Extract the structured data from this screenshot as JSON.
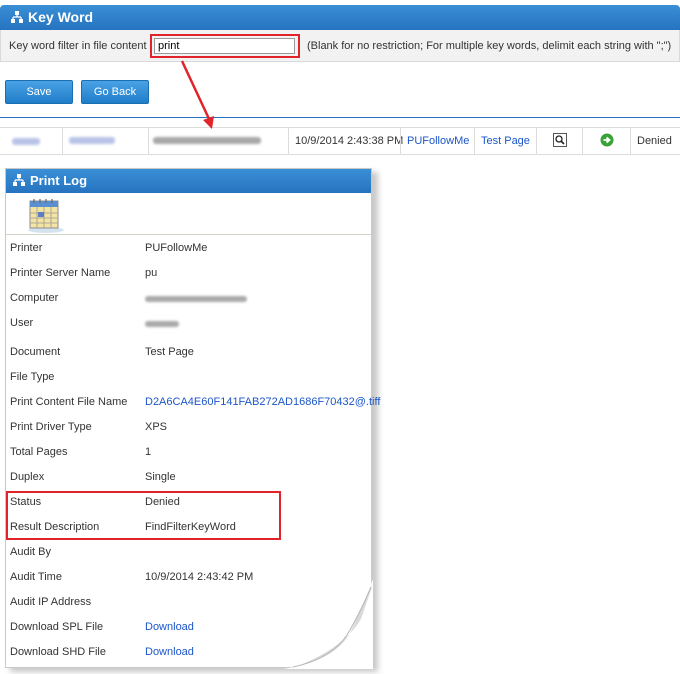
{
  "keyword_panel": {
    "title": "Key Word",
    "filter_label": "Key word filter in file content",
    "filter_value": "print",
    "hint": "(Blank for no restriction; For multiple key words, delimit each string with \";\")",
    "save_label": "Save",
    "back_label": "Go Back"
  },
  "log_row": {
    "datetime": "10/9/2014 2:43:38 PM",
    "printer": "PUFollowMe",
    "document": "Test Page",
    "status": "Denied"
  },
  "print_log": {
    "title": "Print Log",
    "fields": [
      {
        "label": "Printer",
        "value": "PUFollowMe"
      },
      {
        "label": "Printer Server Name",
        "value": "pu"
      },
      {
        "label": "Computer",
        "value": ""
      },
      {
        "label": "User",
        "value": ""
      },
      {
        "label": "Document",
        "value": "Test Page"
      },
      {
        "label": "File Type",
        "value": ""
      },
      {
        "label": "Print Content File Name",
        "value": "D2A6CA4E60F141FAB272AD1686F70432@.tiff"
      },
      {
        "label": "Print Driver Type",
        "value": "XPS"
      },
      {
        "label": "Total Pages",
        "value": "1"
      },
      {
        "label": "Duplex",
        "value": "Single"
      },
      {
        "label": "Status",
        "value": "Denied"
      },
      {
        "label": "Result Description",
        "value": "FindFilterKeyWord"
      },
      {
        "label": "Audit By",
        "value": ""
      },
      {
        "label": "Audit Time",
        "value": "10/9/2014 2:43:42 PM"
      },
      {
        "label": "Audit IP Address",
        "value": ""
      },
      {
        "label": "Download SPL File",
        "value": "Download"
      },
      {
        "label": "Download SHD File",
        "value": "Download"
      }
    ]
  },
  "colors": {
    "header_blue": "#2673c0",
    "highlight_red": "#e0242a",
    "link_blue": "#1c56c9"
  },
  "icons": [
    "sitemap-icon",
    "magnifier-icon",
    "green-arrow-icon",
    "calendar-icon"
  ]
}
